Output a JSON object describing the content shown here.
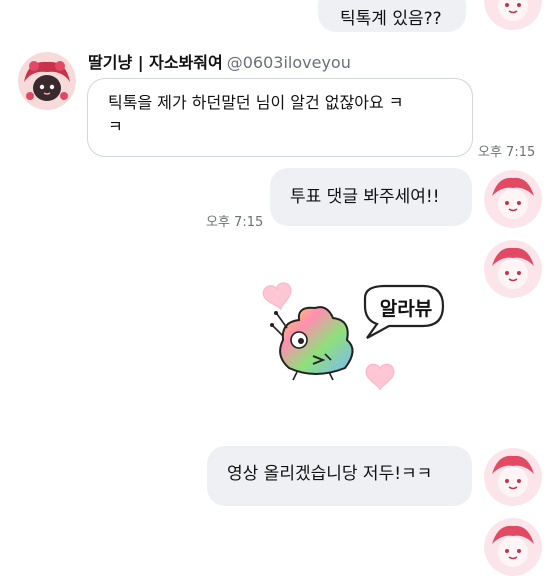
{
  "messages": [
    {
      "type": "sent",
      "text": "틱톡계 있음??"
    },
    {
      "type": "received",
      "sender_name": "딸기냥 | 자소봐줘여",
      "sender_handle": "@0603iloveyou",
      "text_line1": "틱톡을 제가 하던말던 님이 알건 없잖아요 ㅋ",
      "text_line2": "ㅋ",
      "time": "오후 7:15"
    },
    {
      "type": "sent",
      "text": "투표 댓글 봐주세여!!",
      "time": "오후 7:15"
    },
    {
      "type": "sticker",
      "speech_text": "알라뷰"
    },
    {
      "type": "sent",
      "text": "영상 올리겠습니당 저두!ㅋㅋ"
    }
  ],
  "colors": {
    "sent_bubble": "#eef0f3",
    "received_border": "#d3d6db",
    "timestamp": "#6b7078",
    "heart": "#ffc7d3"
  },
  "icons": {
    "sender_avatar": "strawberry-cat-avatar",
    "self_avatar": "pink-character-avatar",
    "sticker": "rainbow-poop-sticker"
  }
}
